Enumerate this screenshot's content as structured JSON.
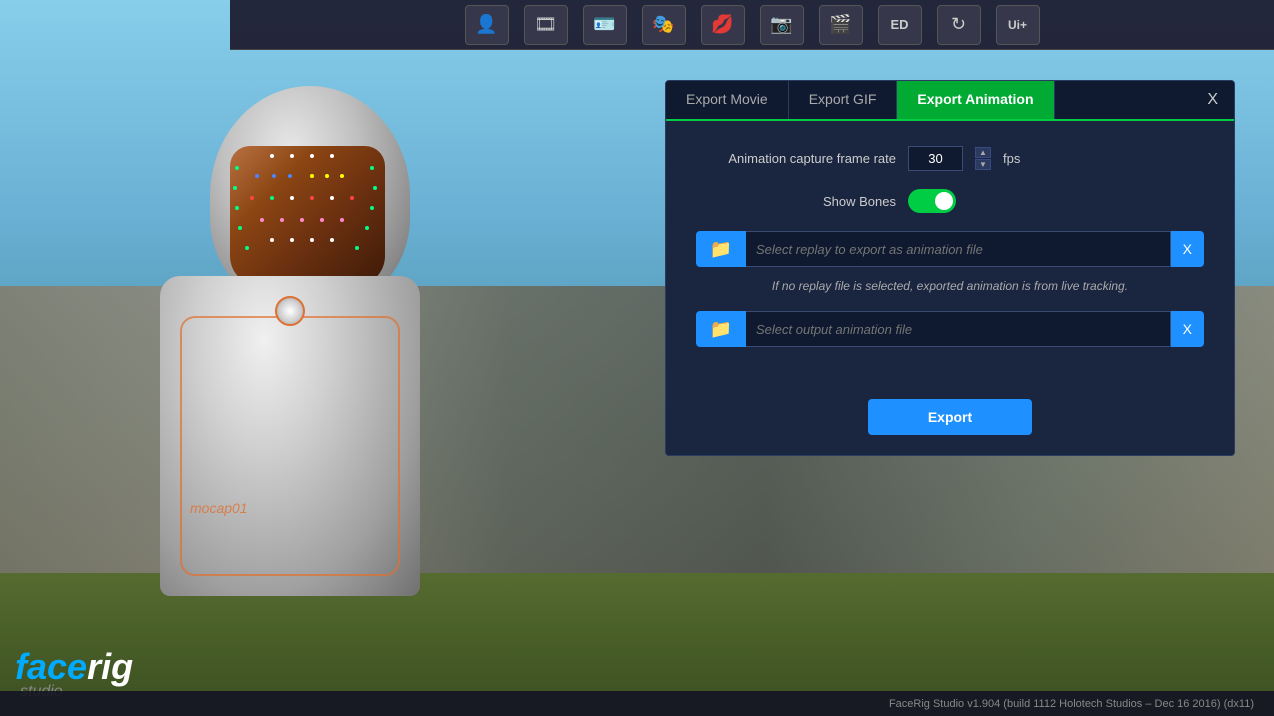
{
  "app": {
    "title": "FaceRig Studio",
    "version": "v1.904 (build 1112 Holotech Studios – Dec 16 2016) (dx11)",
    "logo_face": "face",
    "logo_rig": "rig",
    "logo_studio": "studio"
  },
  "toolbar": {
    "buttons": [
      {
        "id": "person",
        "icon": "👤",
        "label": "Person"
      },
      {
        "id": "camera",
        "icon": "📷",
        "label": "Camera"
      },
      {
        "id": "id-card",
        "icon": "🪪",
        "label": "ID Card"
      },
      {
        "id": "puppet",
        "icon": "🎭",
        "label": "Puppet"
      },
      {
        "id": "mouth",
        "icon": "👄",
        "label": "Mouth"
      },
      {
        "id": "photo",
        "icon": "📸",
        "label": "Photo"
      },
      {
        "id": "film",
        "icon": "🎞️",
        "label": "Film"
      },
      {
        "id": "edit",
        "icon": "📝",
        "label": "Edit"
      },
      {
        "id": "refresh",
        "icon": "🔄",
        "label": "Refresh"
      },
      {
        "id": "ui-plus",
        "icon": "UI+",
        "label": "UI Plus"
      }
    ]
  },
  "dialog": {
    "tabs": [
      {
        "id": "export-movie",
        "label": "Export Movie",
        "active": false
      },
      {
        "id": "export-gif",
        "label": "Export GIF",
        "active": false
      },
      {
        "id": "export-animation",
        "label": "Export Animation",
        "active": true
      }
    ],
    "close_label": "X",
    "frame_rate_label": "Animation capture frame rate",
    "frame_rate_value": "30",
    "frame_rate_unit": "fps",
    "show_bones_label": "Show Bones",
    "show_bones_on": true,
    "replay_placeholder": "Select replay to export as animation file",
    "output_placeholder": "Select output animation file",
    "hint_text": "If no replay file is selected, exported animation is from live tracking.",
    "export_button": "Export"
  },
  "robot": {
    "mocap_label": "mocap01"
  },
  "status": {
    "version_text": "FaceRig Studio v1.904 (build 1112 Holotech Studios – Dec 16 2016) (dx11)"
  }
}
